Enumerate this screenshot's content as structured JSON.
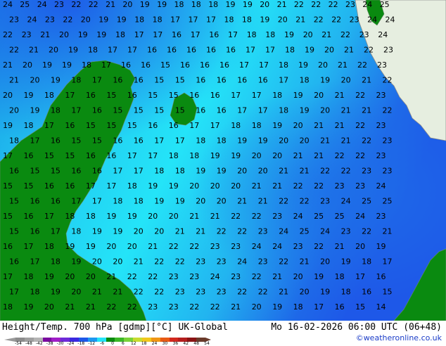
{
  "map": {
    "colors": {
      "cold_edge": "#1e58e8",
      "mid_cyan": "#22c8f0",
      "light_cyan": "#24e4f8",
      "teal": "#12a8d8",
      "land_green": "#0a8a10",
      "land_light": "#e8f0e0",
      "coast_line": "#8a8a8a"
    },
    "contour_rows": [
      "24 25 24 23 22 22 21 20 19 19 18 18 18 19 19 20 21 22 22 22 23 24 25",
      "23 24 23 22 20 19 19 18 18 17 17 17 18 18 19 20 21 22 22 23 24 24",
      "22 23 21 20 19 19 18 17 17 16 17 16 17 18 18 19 20 21 22 23 24",
      "22 21 20 19 18 17 17 16 16 16 16 16 17 17 18 19 20 21 22 23",
      "21 20 19 19 18 17 16 16 15 16 16 16 17 17 18 19 20 21 22 23",
      "21 20 19 18 17 16 16 15 15 16 16 16 16 17 18 19 20 21 22",
      "20 19 18 17 16 15 16 15 15 16 16 17 17 18 19 20 21 22 23",
      "20 19 18 17 16 15 15 15 15 16 16 17 17 18 19 20 21 21 22",
      "19 18 17 16 15 15 15 16 16 17 17 18 18 19 20 21 21 22 23",
      "18 17 16 15 15 16 16 17 17 18 18 19 19 20 20 21 21 22 23",
      "17 16 15 15 16 16 17 17 18 18 19 19 20 20 21 21 22 22 23",
      "16 15 15 16 16 17 17 18 18 19 19 20 20 21 21 22 22 23 23",
      "15 15 16 16 17 17 18 19 19 20 20 20 21 21 22 22 23 23 24",
      "15 16 16 17 17 18 18 19 19 20 20 21 21 22 22 23 24 25 25",
      "15 16 17 18 18 19 19 20 20 21 21 22 22 23 24 25 25 24 23",
      "15 16 17 18 19 19 20 20 21 21 22 22 23 24 25 24 23 22 21",
      "16 17 18 19 19 20 20 21 22 22 23 23 24 24 23 22 21 20 19",
      "16 17 18 19 20 20 21 22 22 23 23 24 23 22 21 20 19 18 17",
      "17 18 19 20 20 21 22 22 23 23 24 23 22 21 20 19 18 17 16",
      "17 18 19 20 21 21 22 22 23 23 23 22 22 21 20 19 18 16 15",
      "18 19 20 21 21 22 22 23 23 22 22 21 20 19 18 17 16 15 14"
    ]
  },
  "footer": {
    "left_text": "Height/Temp. 700 hPa [gdmp][°C] UK-Global",
    "right_text": "Mo 16-02-2026 06:00 UTC (06+48)",
    "credit": "©weatheronline.co.uk"
  },
  "colorbar": {
    "labels": [
      "-54",
      "-48",
      "-42",
      "-38",
      "-30",
      "-24",
      "-18",
      "-12",
      "-6",
      "0",
      "6",
      "12",
      "18",
      "24",
      "30",
      "36",
      "42",
      "48",
      "54"
    ],
    "colors": [
      "#8c8c8c",
      "#a0a0a0",
      "#b4b4b4",
      "#7a0aa0",
      "#a01ec8",
      "#6e2ad8",
      "#3a28e0",
      "#1e58e8",
      "#1e98f0",
      "#24e4f8",
      "#0a8a10",
      "#3cb828",
      "#7ad23a",
      "#c8dc32",
      "#f0c81e",
      "#f09614",
      "#e85a14",
      "#d2281e",
      "#b41e1e",
      "#8a1414",
      "#6a3a2a"
    ]
  }
}
